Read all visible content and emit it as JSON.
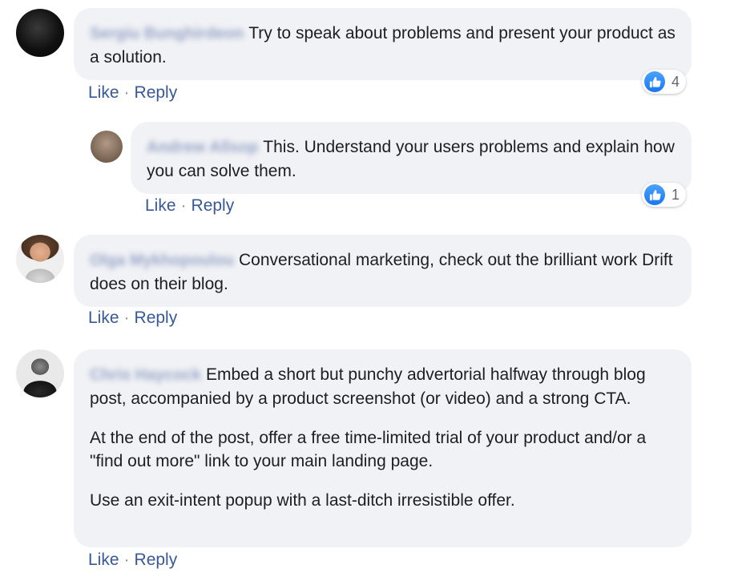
{
  "comments": [
    {
      "author": "Sergiu Bunghirdeon",
      "paragraphs": [
        "Try to speak about problems and present your product as a solution."
      ],
      "reactions": {
        "icon": "thumbs-up-icon",
        "count": "4"
      },
      "actions": {
        "like": "Like",
        "separator": "·",
        "reply": "Reply"
      }
    },
    {
      "author": "Andrew Allsop",
      "paragraphs": [
        "This. Understand your users problems and explain how you can solve them."
      ],
      "reactions": {
        "icon": "thumbs-up-icon",
        "count": "1"
      },
      "actions": {
        "like": "Like",
        "separator": "·",
        "reply": "Reply"
      }
    },
    {
      "author": "Olga Mykhopoulou",
      "paragraphs": [
        "Conversational marketing, check out the brilliant work Drift does on their blog."
      ],
      "actions": {
        "like": "Like",
        "separator": "·",
        "reply": "Reply"
      }
    },
    {
      "author": "Chris Haycock",
      "paragraphs": [
        "Embed a short but punchy advertorial halfway through blog post, accompanied by a product screenshot (or video) and a strong CTA.",
        "At the end of the post, offer a free time-limited trial of your product and/or a \"find out more\" link to your main landing page.",
        "Use an exit-intent popup with a last-ditch irresistible offer."
      ],
      "actions": {
        "like": "Like",
        "separator": "·",
        "reply": "Reply"
      }
    }
  ],
  "colors": {
    "bubble": "#f0f2f5",
    "link": "#385898",
    "like_blue": "#1877f2"
  }
}
